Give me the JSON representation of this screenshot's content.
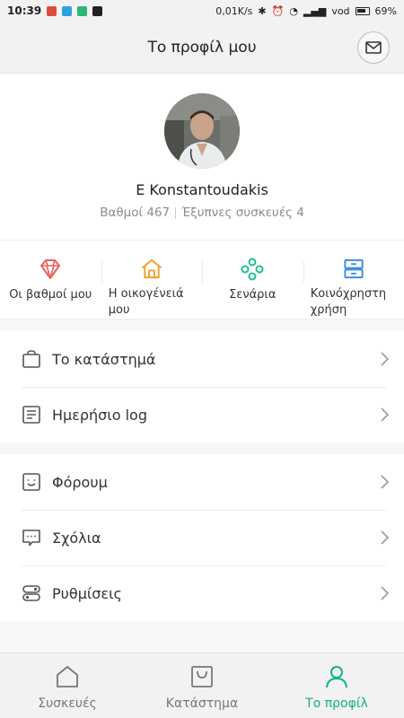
{
  "status_bar": {
    "time": "10:39",
    "net_speed": "0,01K/s",
    "carrier": "vod",
    "battery": "69%"
  },
  "header": {
    "title": "Το προφίλ μου",
    "mail_icon": "mail-icon"
  },
  "profile": {
    "name": "E Konstantoudakis",
    "points": "Βαθμοί 467",
    "devices": "Έξυπνες συσκευές 4"
  },
  "shortcuts": [
    {
      "label": "Οι βαθμοί μου",
      "icon": "diamond-icon",
      "color": "#e8635a"
    },
    {
      "label": "Η οικογένειά μου",
      "icon": "house-icon",
      "color": "#f0a030"
    },
    {
      "label": "Σενάρια",
      "icon": "scenes-icon",
      "color": "#1fbf98"
    },
    {
      "label": "Κοινόχρηστη χρήση",
      "icon": "share-icon",
      "color": "#3e8ee0"
    }
  ],
  "menu_group_1": [
    {
      "label": "Το κατάστημά",
      "icon": "bag-icon"
    },
    {
      "label": "Ημερήσιο log",
      "icon": "log-icon"
    }
  ],
  "menu_group_2": [
    {
      "label": "Φόρουμ",
      "icon": "forum-icon"
    },
    {
      "label": "Σχόλια",
      "icon": "comment-icon"
    },
    {
      "label": "Ρυθμίσεις",
      "icon": "settings-icon"
    }
  ],
  "tabs": [
    {
      "label": "Συσκευές",
      "icon": "home-icon",
      "active": false
    },
    {
      "label": "Κατάστημα",
      "icon": "store-icon",
      "active": false
    },
    {
      "label": "Το προφίλ",
      "icon": "person-icon",
      "active": true
    }
  ],
  "colors": {
    "accent": "#14b18b"
  }
}
